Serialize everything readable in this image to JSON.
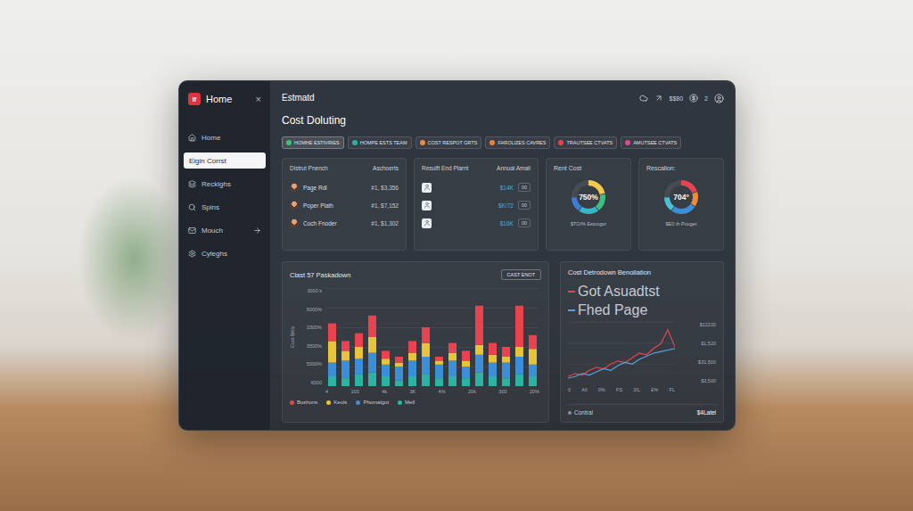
{
  "window": {
    "title": "Estmatd",
    "subtitle": "Cost Doluting"
  },
  "sidebar": {
    "brand": {
      "logo": "If",
      "name": "Home",
      "close": "×"
    },
    "items": [
      {
        "label": "Home",
        "selected": false,
        "kind": "plain"
      },
      {
        "label": "Eigin Corrst",
        "selected": true,
        "kind": "plain"
      },
      {
        "label": "Recklghs",
        "selected": false,
        "kind": "plain"
      },
      {
        "label": "Spins",
        "selected": false,
        "kind": "plain"
      },
      {
        "label": "Mouch",
        "selected": false,
        "kind": "submenu"
      },
      {
        "label": "Cyleghs",
        "selected": false,
        "kind": "plain"
      }
    ]
  },
  "toolbar": {
    "balance": "$$80",
    "count": "2"
  },
  "filters": [
    {
      "label": "HOMHE ESTIVRIES",
      "color": "#3fbf7f",
      "selected": true
    },
    {
      "label": "HOMPE ESTS TEAM",
      "color": "#2bb3a3",
      "selected": false
    },
    {
      "label": "COST RESPOT GRTS",
      "color": "#f08a3c",
      "selected": false
    },
    {
      "label": "FAROLIZES CAVRES",
      "color": "#e8813a",
      "selected": false
    },
    {
      "label": "TRAUTSEE CTVATS",
      "color": "#e8434f",
      "selected": false
    },
    {
      "label": "AMUTSEE CTVATS",
      "color": "#d94a8c",
      "selected": false
    }
  ],
  "team_card": {
    "columns": [
      "Distrut Pnench",
      "Aschoerts"
    ],
    "rows": [
      {
        "name": "Page Rdl",
        "value": "#1, $3,356"
      },
      {
        "name": "Poper Plath",
        "value": "#1, $7,152"
      },
      {
        "name": "Coch Fnoder",
        "value": "#1, $1,302"
      }
    ]
  },
  "plant_card": {
    "columns": [
      "Resulft End Plarnt",
      "Annual Amail"
    ],
    "rows": [
      {
        "value": "$14K",
        "tag": "00"
      },
      {
        "value": "$K/72",
        "tag": "00"
      },
      {
        "value": "$16K",
        "tag": "00"
      }
    ]
  },
  "gauges": [
    {
      "title": "Rent Cost",
      "value": "750%",
      "caption": "$TO/% Estcogor",
      "segments": [
        {
          "level": 0.22,
          "color": "#f2c94c"
        },
        {
          "level": 0.18,
          "color": "#3fbf7f"
        },
        {
          "level": 0.2,
          "color": "#38b6c9"
        },
        {
          "level": 0.15,
          "color": "#3b7dd8"
        }
      ]
    },
    {
      "title": "Rescalion:",
      "value": "704°",
      "caption": "$E0 th Puuget",
      "segments": [
        {
          "level": 0.2,
          "color": "#e8434f"
        },
        {
          "level": 0.15,
          "color": "#f08a3c"
        },
        {
          "level": 0.25,
          "color": "#3b8fd9"
        },
        {
          "level": 0.15,
          "color": "#46c1d6"
        }
      ]
    }
  ],
  "bar_chart": {
    "title": "Clast 57 Paskadown",
    "button": "CAST ENOT",
    "axis_title": "Cost $tbly",
    "max": 100,
    "y_ticks": [
      "3000 k",
      "5000%",
      "3300%",
      "3500%",
      "5000%",
      "6000"
    ],
    "x_ticks": [
      "4",
      "100",
      "4k",
      "3K",
      "4%",
      "20k",
      "300",
      "20%"
    ],
    "series": [
      {
        "name": "Bushons",
        "color": "#e8434f",
        "values": [
          18,
          10,
          14,
          22,
          8,
          6,
          12,
          16,
          4,
          10,
          10,
          40,
          12,
          10,
          42,
          14
        ]
      },
      {
        "name": "Keols",
        "color": "#e6c33a",
        "values": [
          22,
          10,
          12,
          16,
          6,
          4,
          8,
          14,
          4,
          8,
          6,
          10,
          8,
          6,
          10,
          16
        ]
      },
      {
        "name": "Phomalgot",
        "color": "#3b8fd9",
        "values": [
          14,
          18,
          16,
          20,
          12,
          14,
          16,
          18,
          14,
          16,
          12,
          18,
          14,
          16,
          18,
          12
        ]
      },
      {
        "name": "Mell",
        "color": "#2bb3a3",
        "values": [
          10,
          8,
          12,
          14,
          10,
          6,
          10,
          12,
          8,
          10,
          8,
          14,
          10,
          8,
          12,
          10
        ]
      }
    ]
  },
  "line_chart": {
    "title": "Cost Detrodown Benoliation",
    "max": 80,
    "series": [
      {
        "name": "Got Asuadtst",
        "color": "#e8434f",
        "values": [
          10,
          14,
          12,
          18,
          22,
          20,
          26,
          30,
          28,
          34,
          40,
          38,
          46,
          52,
          70,
          48
        ]
      },
      {
        "name": "Fhed Page",
        "color": "#5aa0e0",
        "values": [
          8,
          10,
          14,
          12,
          16,
          20,
          18,
          24,
          28,
          26,
          32,
          36,
          40,
          42,
          44,
          46
        ]
      }
    ],
    "y_ticks": [
      "$12220",
      "$1,520",
      "$31,500",
      "$3,500"
    ],
    "x_ticks": [
      "0",
      "All",
      "0%",
      "FS",
      "3/L",
      "£%",
      "FL"
    ],
    "footer": {
      "label": "Contral",
      "value": "$4Latel"
    }
  }
}
